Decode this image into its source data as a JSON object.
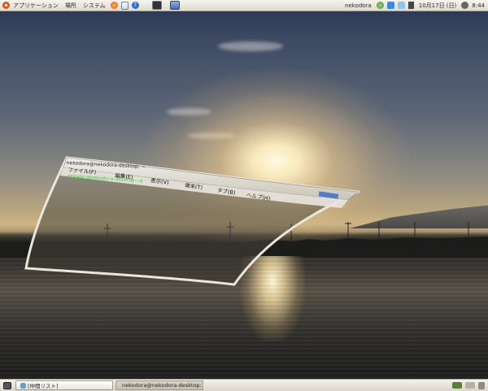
{
  "top_panel": {
    "menus": [
      "アプリケーション",
      "場所",
      "システム"
    ],
    "user": "nekodora",
    "date": "10月17日 (日)",
    "time": "8:44"
  },
  "window": {
    "title": "nekodora@nekodora-desktop: ~",
    "menus": [
      "ファイル(F)",
      "編集(E)",
      "表示(V)",
      "端末(T)",
      "タブ(B)",
      "ヘルプ(H)"
    ],
    "prompt": "nekodora@nekodora-desktop:~$"
  },
  "bottom_panel": {
    "tasks": [
      "[仲間リスト]",
      "nekodora@nekodora-desktop: ~"
    ]
  },
  "colors": {
    "ubuntu_orange": "#d45a1e",
    "terminal_green": "#2fd12f"
  }
}
